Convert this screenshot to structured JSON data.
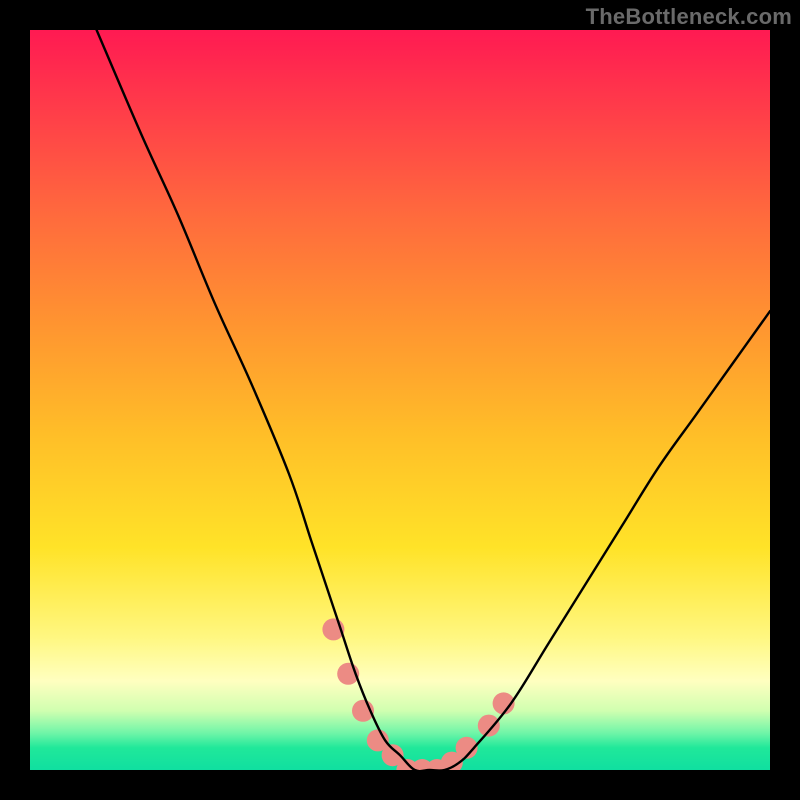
{
  "watermark": "TheBottleneck.com",
  "chart_data": {
    "type": "line",
    "title": "",
    "xlabel": "",
    "ylabel": "",
    "xlim": [
      0,
      100
    ],
    "ylim": [
      0,
      100
    ],
    "grid": false,
    "legend": false,
    "series": [
      {
        "name": "bottleneck-curve",
        "color": "#000000",
        "x": [
          9,
          15,
          20,
          25,
          30,
          35,
          38,
          40,
          42,
          44,
          46,
          48,
          50,
          52,
          54,
          56,
          58,
          60,
          65,
          70,
          75,
          80,
          85,
          90,
          95,
          100
        ],
        "y": [
          100,
          86,
          75,
          63,
          52,
          40,
          31,
          25,
          19,
          13,
          8,
          4,
          2,
          0,
          0,
          0,
          1,
          3,
          9,
          17,
          25,
          33,
          41,
          48,
          55,
          62
        ]
      }
    ],
    "markers": {
      "name": "highlight-dots",
      "color": "#ec8b84",
      "points": [
        {
          "x": 41,
          "y": 19
        },
        {
          "x": 43,
          "y": 13
        },
        {
          "x": 45,
          "y": 8
        },
        {
          "x": 47,
          "y": 4
        },
        {
          "x": 49,
          "y": 2
        },
        {
          "x": 51,
          "y": 0
        },
        {
          "x": 53,
          "y": 0
        },
        {
          "x": 55,
          "y": 0
        },
        {
          "x": 57,
          "y": 1
        },
        {
          "x": 59,
          "y": 3
        },
        {
          "x": 62,
          "y": 6
        },
        {
          "x": 64,
          "y": 9
        }
      ]
    }
  }
}
